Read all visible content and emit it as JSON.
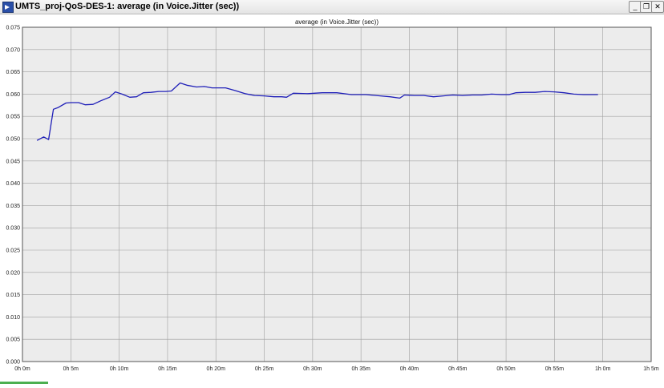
{
  "window": {
    "title": "UMTS_proj-QoS-DES-1: average (in Voice.Jitter (sec))",
    "minimize_glyph": "_",
    "restore_glyph": "❐",
    "close_glyph": "✕"
  },
  "colors": {
    "series": "#1f1fb8",
    "plot_bg": "#ececec",
    "grid": "#a0a0a0"
  },
  "chart_data": {
    "type": "line",
    "title": "average (in Voice.Jitter (sec))",
    "xlabel": "",
    "ylabel": "",
    "xlim": [
      0,
      65
    ],
    "ylim": [
      0,
      0.075
    ],
    "grid": true,
    "x_ticks": [
      "0h 0m",
      "0h 5m",
      "0h 10m",
      "0h 15m",
      "0h 20m",
      "0h 25m",
      "0h 30m",
      "0h 35m",
      "0h 40m",
      "0h 45m",
      "0h 50m",
      "0h 55m",
      "1h 0m",
      "1h 5m"
    ],
    "y_ticks": [
      "0.000",
      "0.005",
      "0.010",
      "0.015",
      "0.020",
      "0.025",
      "0.030",
      "0.035",
      "0.040",
      "0.045",
      "0.050",
      "0.055",
      "0.060",
      "0.065",
      "0.070",
      "0.075"
    ],
    "series": [
      {
        "x": [
          1.5,
          2.2,
          2.7,
          3.2,
          3.7,
          4.5,
          5.0,
          5.8,
          6.5,
          7.3,
          8.1,
          9.0,
          9.6,
          10.3,
          11.1,
          11.8,
          12.5,
          13.3,
          14.1,
          14.8,
          15.4,
          16.3,
          17.0,
          18.0,
          18.8,
          19.6,
          20.4,
          21.0,
          22.0,
          23.0,
          24.0,
          25.0,
          26.0,
          26.8,
          27.3,
          28.0,
          29.5,
          31.0,
          32.5,
          34.0,
          35.5,
          37.0,
          38.0,
          39.0,
          39.5,
          40.5,
          41.5,
          42.5,
          43.5,
          44.5,
          45.5,
          46.5,
          47.5,
          48.5,
          49.5,
          50.3,
          51.0,
          52.0,
          53.0,
          54.0,
          55.0,
          56.0,
          57.0,
          58.0,
          59.0,
          59.5
        ],
        "y": [
          0.0496,
          0.0504,
          0.0498,
          0.0566,
          0.057,
          0.058,
          0.0581,
          0.0581,
          0.0576,
          0.0577,
          0.0585,
          0.0593,
          0.0605,
          0.06,
          0.0593,
          0.0594,
          0.0603,
          0.0604,
          0.0606,
          0.0606,
          0.0607,
          0.0625,
          0.062,
          0.0616,
          0.0617,
          0.0614,
          0.0614,
          0.0614,
          0.0608,
          0.0601,
          0.0597,
          0.0596,
          0.0594,
          0.0594,
          0.0593,
          0.0602,
          0.0601,
          0.0603,
          0.0603,
          0.0599,
          0.0599,
          0.0596,
          0.0594,
          0.0591,
          0.0598,
          0.0597,
          0.0597,
          0.0594,
          0.0596,
          0.0598,
          0.0597,
          0.0598,
          0.0598,
          0.06,
          0.0599,
          0.0599,
          0.0603,
          0.0604,
          0.0604,
          0.0606,
          0.0605,
          0.0603,
          0.06,
          0.0599,
          0.0599,
          0.0599
        ]
      }
    ]
  }
}
